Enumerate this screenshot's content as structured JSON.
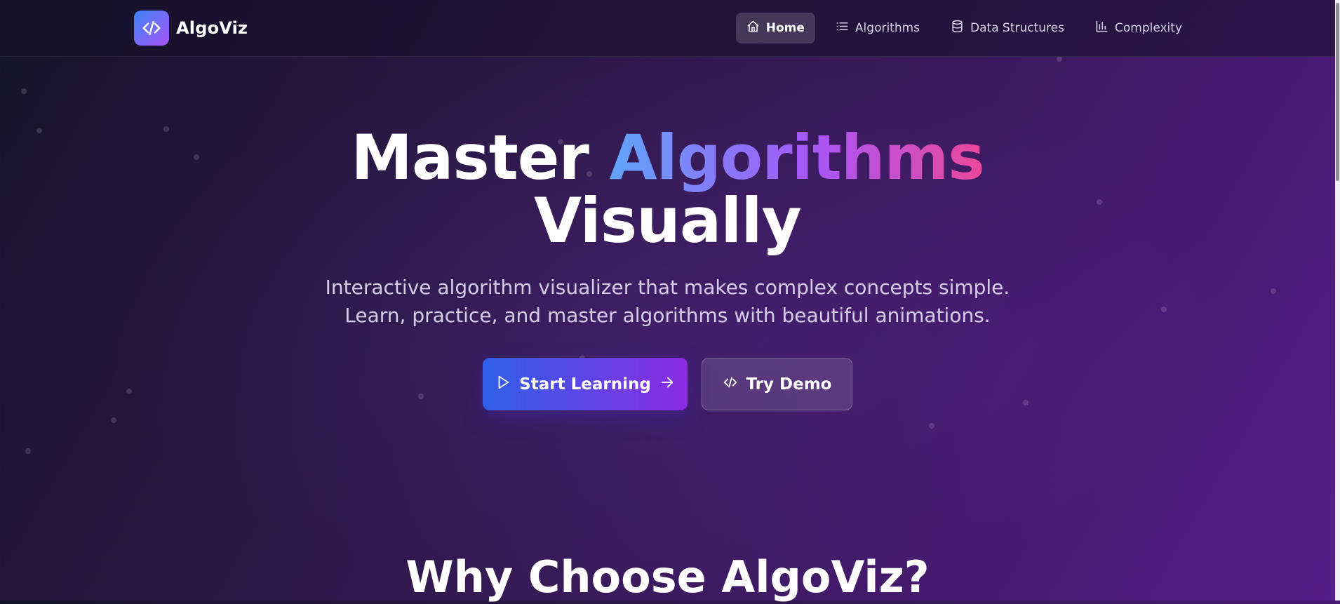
{
  "brand": {
    "name": "AlgoViz",
    "icon": "code-icon"
  },
  "nav": {
    "items": [
      {
        "label": "Home",
        "icon": "home-icon",
        "active": true
      },
      {
        "label": "Algorithms",
        "icon": "list-icon",
        "active": false
      },
      {
        "label": "Data Structures",
        "icon": "database-icon",
        "active": false
      },
      {
        "label": "Complexity",
        "icon": "bar-chart-icon",
        "active": false
      }
    ]
  },
  "hero": {
    "title_part1": "Master ",
    "title_highlight": "Algorithms",
    "title_part2": "Visually",
    "subtitle_line1": "Interactive algorithm visualizer that makes complex concepts simple.",
    "subtitle_line2": "Learn, practice, and master algorithms with beautiful animations.",
    "primary_button": "Start Learning",
    "secondary_button": "Try Demo"
  },
  "section": {
    "title": "Why Choose AlgoViz?"
  },
  "colors": {
    "accent_blue": "#3b82f6",
    "accent_purple": "#a855f7",
    "accent_pink": "#ec4899",
    "background_dark": "#15132b",
    "background_purple": "#561c8a"
  }
}
